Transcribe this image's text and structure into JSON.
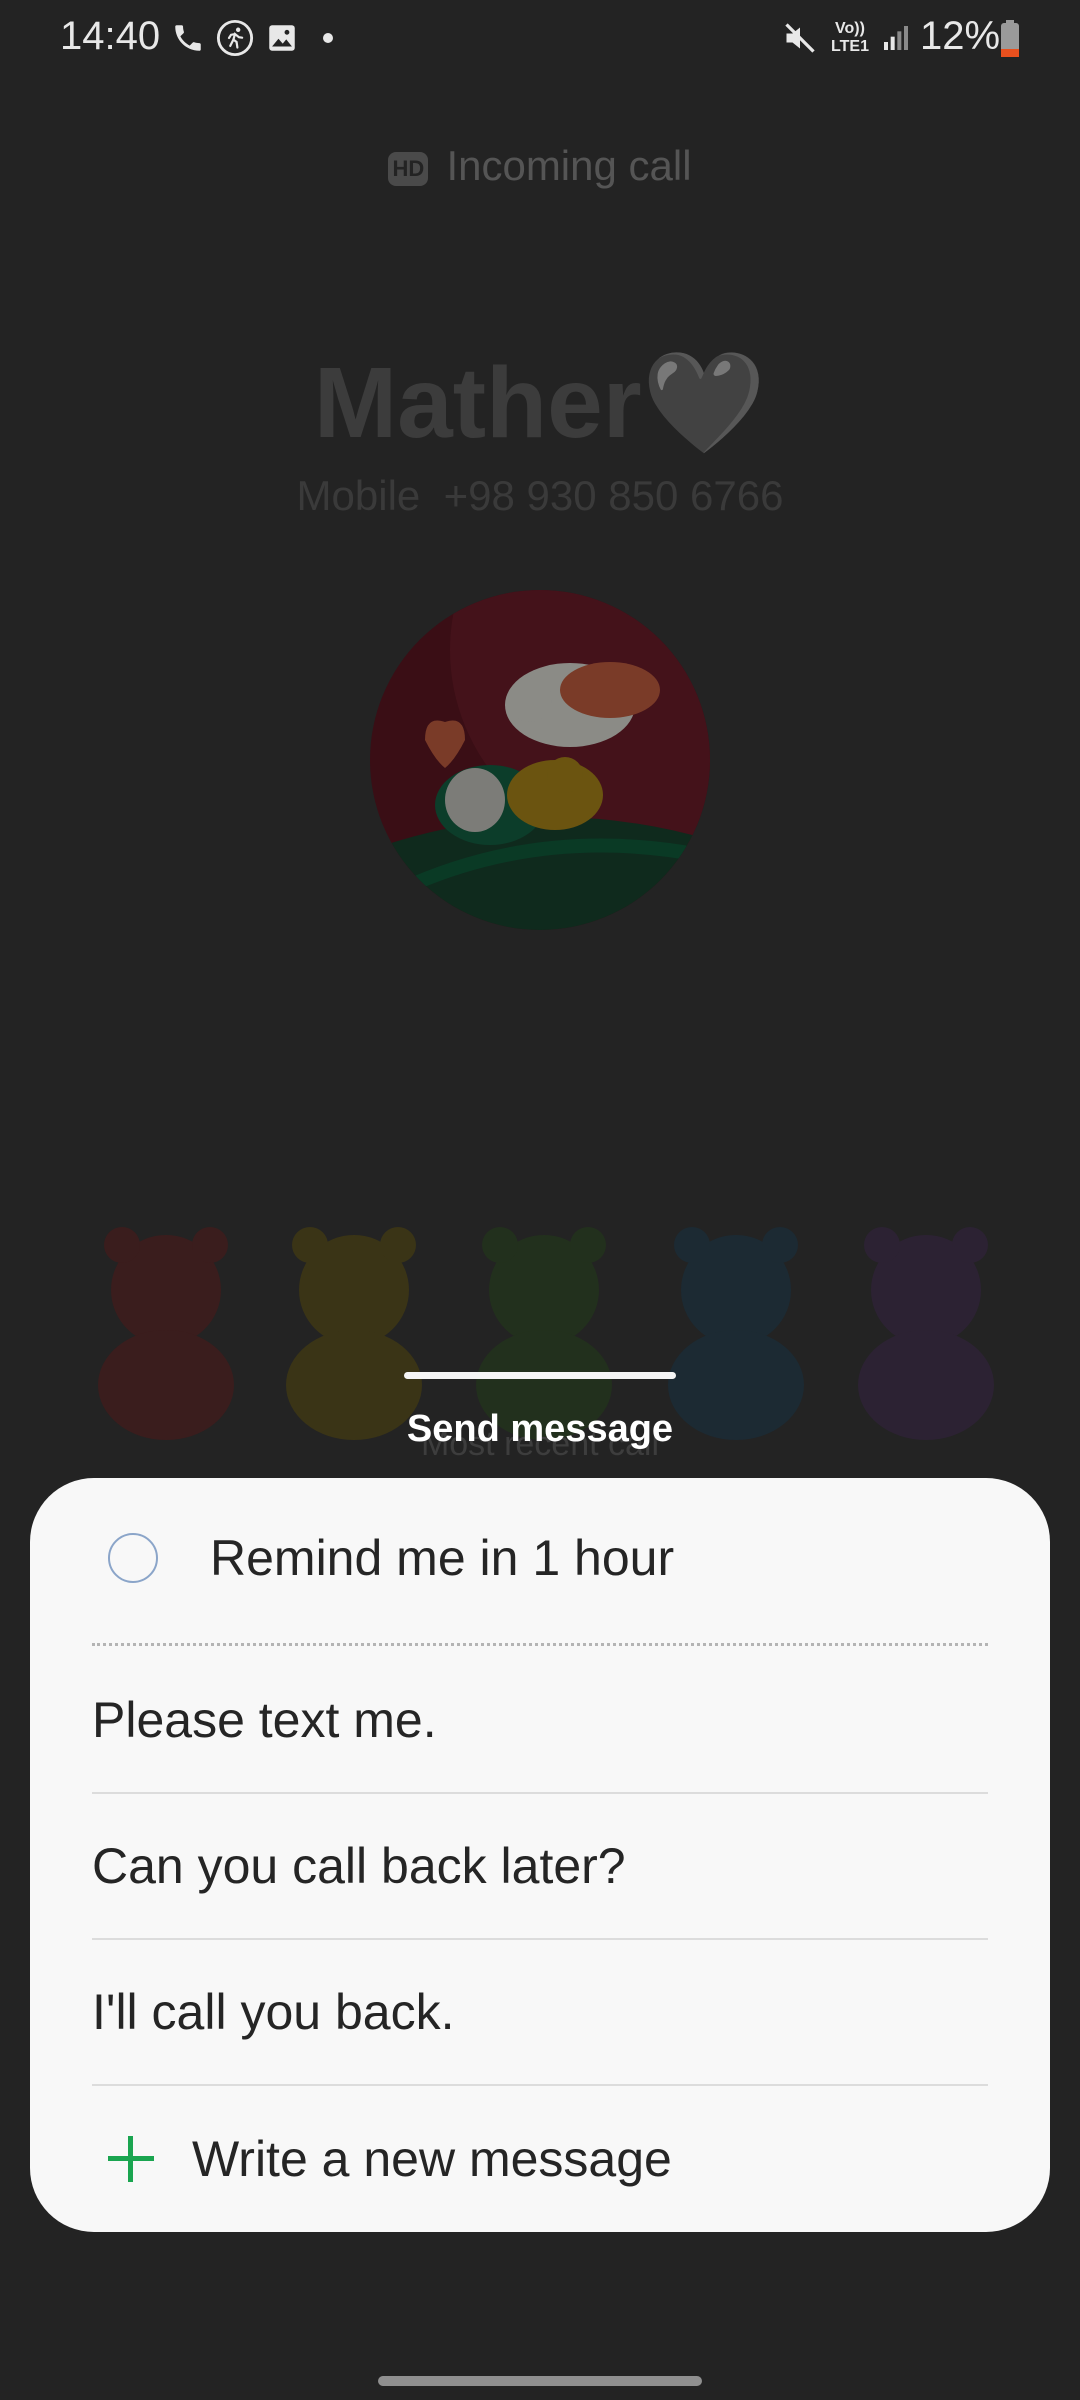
{
  "status_bar": {
    "time": "14:40",
    "left_icons": [
      "phone-icon",
      "running-icon",
      "gallery-icon",
      "dot-icon"
    ],
    "right_icons": [
      "mute-icon",
      "volte-lte-icon",
      "signal-icon",
      "battery-icon"
    ],
    "network_label_top": "Vo))",
    "network_label_bottom": "LTE1",
    "battery_percent": "12%",
    "battery_level": 0.12
  },
  "call": {
    "hd_badge": "HD",
    "status": "Incoming call",
    "caller_name": "Mather",
    "caller_emoji": "🖤",
    "number_type": "Mobile",
    "number": "+98 930 850 6766",
    "recent_call_label": "Most recent call"
  },
  "sheet": {
    "title": "Send message",
    "remind_label": "Remind me in 1 hour",
    "messages": [
      "Please text me.",
      "Can you call back later?",
      "I'll call you back."
    ],
    "write_new_label": "Write a new message"
  },
  "colors": {
    "background": "#232323",
    "sheet_bg": "#f8f8f8",
    "accent_green": "#1aa550",
    "radio_border": "#8ba5c9"
  }
}
